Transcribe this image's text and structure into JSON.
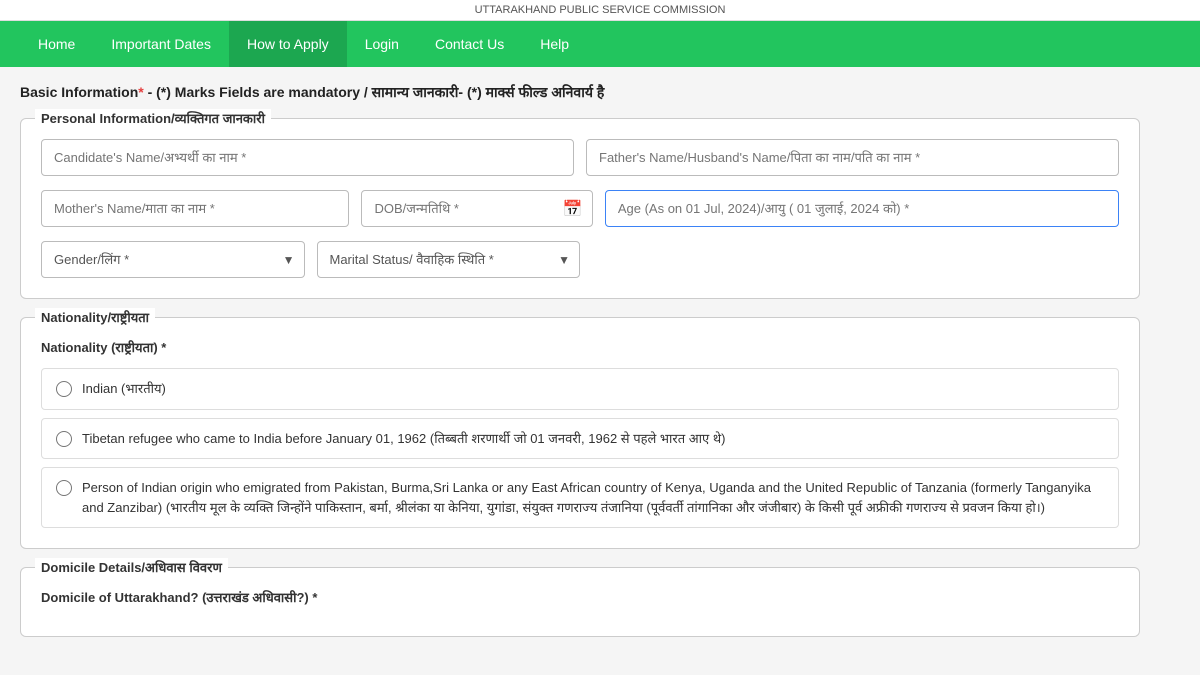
{
  "topbar": {
    "text": "UTTARAKHAND PUBLIC SERVICE COMMISSION"
  },
  "nav": {
    "items": [
      {
        "id": "home",
        "label": "Home"
      },
      {
        "id": "important-dates",
        "label": "Important Dates"
      },
      {
        "id": "how-to-apply",
        "label": "How to Apply"
      },
      {
        "id": "login",
        "label": "Login"
      },
      {
        "id": "contact-us",
        "label": "Contact Us"
      },
      {
        "id": "help",
        "label": "Help"
      }
    ]
  },
  "page": {
    "title_en": "Basic Information",
    "title_suffix": " - (*) Marks Fields are mandatory / सामान्य जानकारी- (*) मार्क्स फील्ड अनिवार्य है"
  },
  "personal_info": {
    "legend": "Personal Information/व्यक्तिगत जानकारी",
    "candidate_name_placeholder": "Candidate's Name/अभ्यर्थी का नाम *",
    "father_name_placeholder": "Father's Name/Husband's Name/पिता का नाम/पति का नाम *",
    "mother_name_placeholder": "Mother's Name/माता का नाम *",
    "dob_placeholder": "DOB/जन्मतिथि *",
    "age_placeholder": "Age (As on 01 Jul, 2024)/आयु ( 01 जुलाई, 2024 को) *",
    "gender_placeholder": "Gender/लिंग *",
    "marital_placeholder": "Marital Status/ वैवाहिक स्थिति *"
  },
  "nationality": {
    "legend": "Nationality/राष्ट्रीयता",
    "label": "Nationality (राष्ट्रीयता) *",
    "options": [
      {
        "id": "indian",
        "text_en": "Indian",
        "text_hi": "(भारतीय)"
      },
      {
        "id": "tibetan",
        "text_en": "Tibetan refugee who came to India before January 01, 1962",
        "text_hi": "(तिब्बती शरणार्थी जो 01 जनवरी, 1962 से पहले भारत आए थे)"
      },
      {
        "id": "indian-origin",
        "text_en": "Person of Indian origin who emigrated from Pakistan, Burma,Sri Lanka or any East African country of Kenya, Uganda and the United Republic of Tanzania (formerly Tanganyika and Zanzibar)",
        "text_hi": "(भारतीय मूल के व्यक्ति जिन्होंने पाकिस्तान, बर्मा, श्रीलंका या केनिया, युगांडा, संयुक्त गणराज्य तंजानिया (पूर्ववर्ती तांगानिका और जंजीबार) के किसी पूर्व अफ्रीकी गणराज्य से प्रवजन किया हो।)"
      }
    ]
  },
  "domicile": {
    "legend": "Domicile Details/अधिवास विवरण",
    "label": "Domicile of Uttarakhand? (उत्तराखंड अधिवासी?) *"
  },
  "colors": {
    "nav_bg": "#22c55e",
    "active_nav": "rgba(0,0,0,0.15)",
    "accent": "#3b82f6",
    "mandatory": "#e53e3e"
  }
}
